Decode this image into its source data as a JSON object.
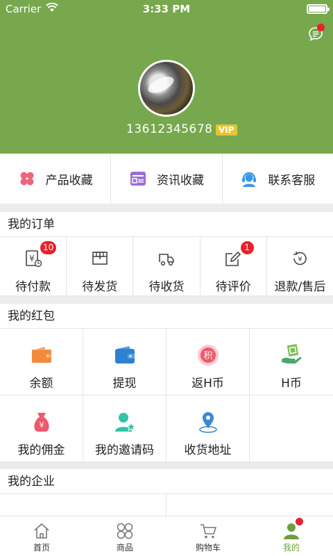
{
  "status_bar": {
    "carrier": "Carrier",
    "time": "3:33 PM"
  },
  "profile": {
    "phone": "13612345678",
    "vip": "VIP"
  },
  "favorites": [
    {
      "label": "产品收藏",
      "icon": "clover-icon"
    },
    {
      "label": "资讯收藏",
      "icon": "news-card-icon"
    },
    {
      "label": "联系客服",
      "icon": "headset-icon"
    }
  ],
  "orders": {
    "title": "我的订单",
    "items": [
      {
        "label": "待付款",
        "icon": "payment-pending-icon",
        "badge": "10"
      },
      {
        "label": "待发货",
        "icon": "box-icon",
        "badge": ""
      },
      {
        "label": "待收货",
        "icon": "truck-icon",
        "badge": ""
      },
      {
        "label": "待评价",
        "icon": "edit-icon",
        "badge": "1"
      },
      {
        "label": "退款/售后",
        "icon": "refund-icon",
        "badge": ""
      }
    ]
  },
  "red_packets": {
    "title": "我的红包",
    "items": [
      {
        "label": "余额",
        "icon": "wallet-icon"
      },
      {
        "label": "提现",
        "icon": "withdraw-icon"
      },
      {
        "label": "返H币",
        "icon": "points-icon"
      },
      {
        "label": "H币",
        "icon": "coin-hand-icon"
      },
      {
        "label": "我的佣金",
        "icon": "money-bag-icon"
      },
      {
        "label": "我的邀请码",
        "icon": "user-star-icon"
      },
      {
        "label": "收货地址",
        "icon": "location-icon"
      }
    ]
  },
  "enterprise": {
    "title": "我的企业"
  },
  "tabbar": [
    {
      "label": "首页",
      "icon": "home-icon",
      "active": false
    },
    {
      "label": "商品",
      "icon": "grid-icon",
      "active": false
    },
    {
      "label": "购物车",
      "icon": "cart-icon",
      "active": false
    },
    {
      "label": "我的",
      "icon": "user-icon",
      "active": true
    }
  ],
  "colors": {
    "header": "#77a84d",
    "badge": "#e8212a",
    "vip": "#e6c630",
    "active_tab": "#6ea03f"
  }
}
